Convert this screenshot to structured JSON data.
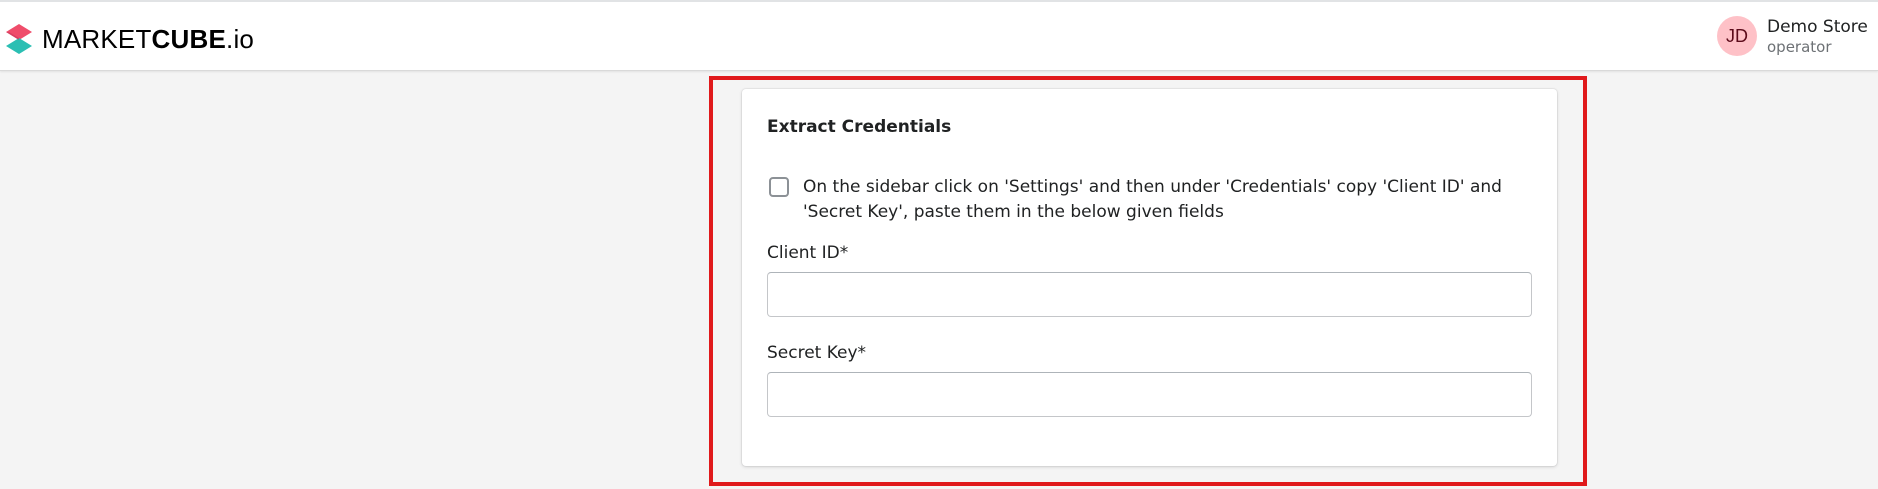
{
  "header": {
    "logo": {
      "part1": "MARKET",
      "part2": "CUBE",
      "part3": ".io",
      "colors": {
        "top": "#ef4d6b",
        "bottom": "#2bbfb3"
      }
    },
    "user": {
      "initials": "JD",
      "name": "Demo Store",
      "role": "operator",
      "avatar_color": "#fec1c7"
    }
  },
  "card": {
    "title": "Extract Credentials",
    "checkbox": {
      "checked": false,
      "label": "On the sidebar click on 'Settings' and then under 'Credentials' copy 'Client ID' and 'Secret Key', paste them in the below given fields"
    },
    "client_id": {
      "label": "Client ID*",
      "value": "",
      "placeholder": ""
    },
    "secret_key": {
      "label": "Secret Key*",
      "value": "",
      "placeholder": ""
    }
  },
  "highlight_color": "#e0191b"
}
